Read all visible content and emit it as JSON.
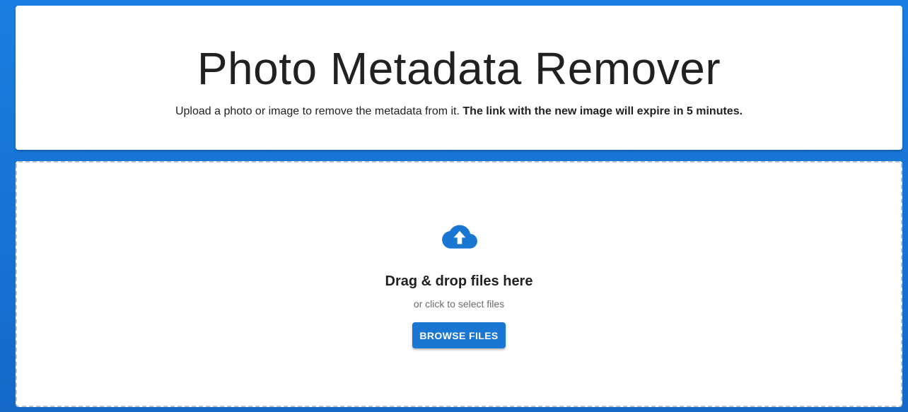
{
  "header": {
    "title": "Photo Metadata Remover",
    "description_plain": "Upload a photo or image to remove the metadata from it.",
    "description_bold": "The link with the new image will expire in 5 minutes."
  },
  "dropzone": {
    "icon": "cloud-upload-icon",
    "title": "Drag & drop files here",
    "subtitle": "or click to select files",
    "browse_label": "BROWSE FILES"
  },
  "colors": {
    "background": "#1a7ee0",
    "accent": "#1976d2",
    "card": "#ffffff",
    "dashed_border": "#b9c4cf"
  }
}
